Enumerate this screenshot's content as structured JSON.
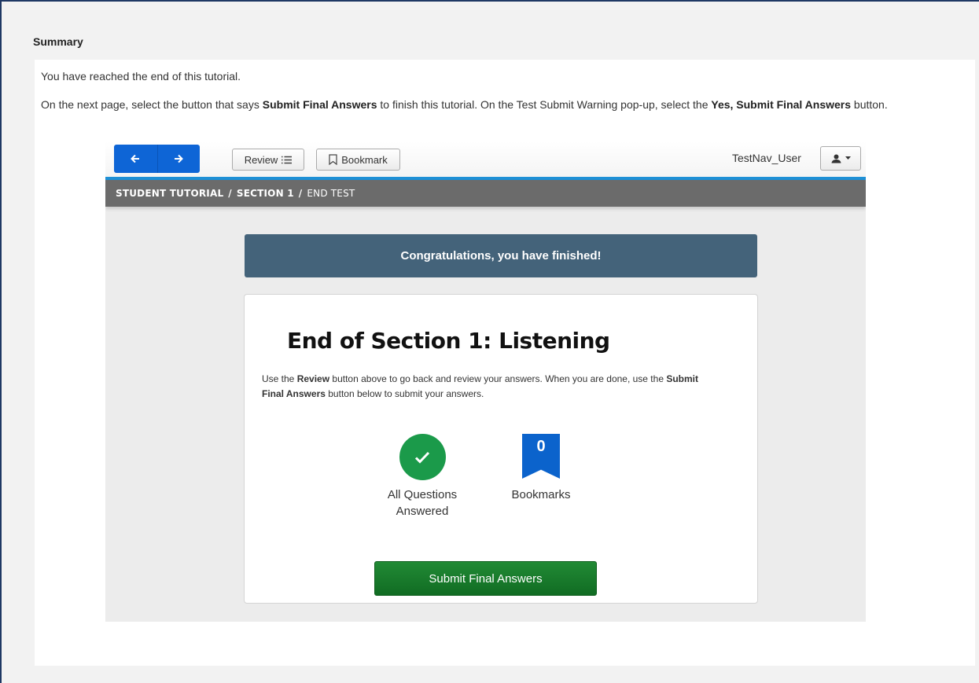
{
  "summary": {
    "title": "Summary",
    "intro": "You have reached the end of this tutorial.",
    "instructions": {
      "part1": "On the next page, select the button that says ",
      "bold1": "Submit Final Answers",
      "part2": " to finish this tutorial. On the Test Submit Warning pop-up, select the ",
      "bold2": "Yes, Submit Final Answers",
      "part3": " button."
    }
  },
  "toolbar": {
    "back_icon": "arrow-left-icon",
    "next_icon": "arrow-right-icon",
    "review_label": "Review",
    "review_icon": "list-icon",
    "bookmark_label": "Bookmark",
    "bookmark_icon": "bookmark-icon",
    "user_name": "TestNav_User",
    "user_icon": "user-icon"
  },
  "breadcrumb": {
    "items": [
      "STUDENT TUTORIAL",
      "SECTION 1",
      "END TEST"
    ],
    "separator": "/"
  },
  "banner": "Congratulations, you have finished!",
  "card": {
    "title": "End of Section 1: Listening",
    "desc": {
      "part1": "Use the ",
      "bold1": "Review",
      "part2": " button above to go back and review your answers. When you are done, use the ",
      "bold2": "Submit Final Answers",
      "part3": " button below to submit your answers."
    },
    "answered_line1": "All Questions",
    "answered_line2": "Answered",
    "bookmark_count": "0",
    "bookmarks_label": "Bookmarks",
    "submit_label": "Submit Final Answers"
  },
  "colors": {
    "nav_blue": "#0e65d6",
    "accent_blue": "#1e90d6",
    "banner": "#44637a",
    "success_green": "#1b9a4a",
    "submit_green": "#167a2c",
    "ribbon_blue": "#0b63cc"
  }
}
